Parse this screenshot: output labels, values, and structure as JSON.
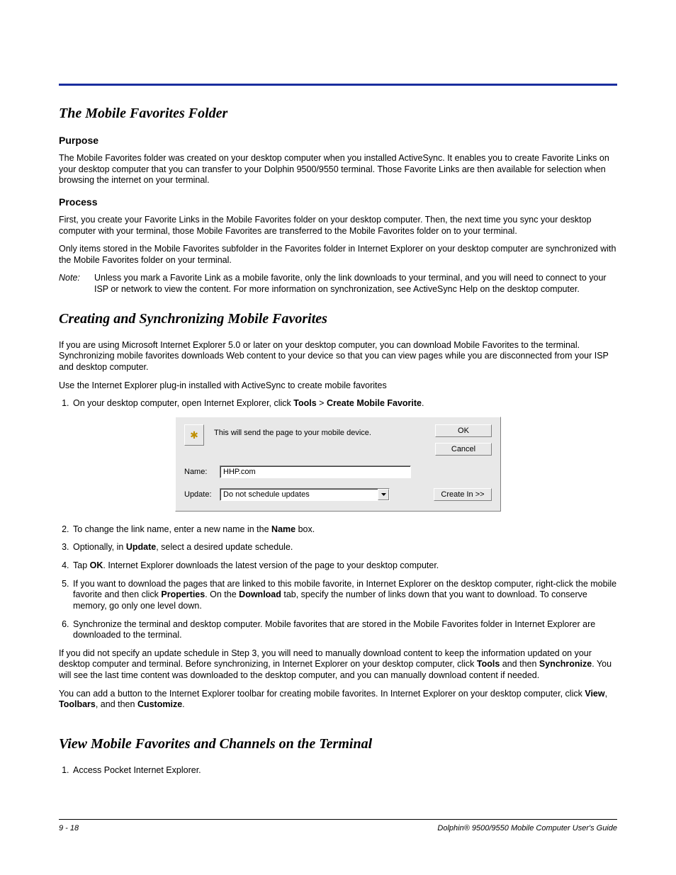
{
  "sections": {
    "s1": {
      "title": "The Mobile Favorites Folder",
      "purpose_h": "Purpose",
      "purpose_p": "The Mobile Favorites folder was created on your desktop computer when you installed ActiveSync. It enables you to create Favorite Links on your desktop computer that you can transfer to your Dolphin 9500/9550 terminal. Those Favorite Links are then available for selection when browsing the internet on your terminal.",
      "process_h": "Process",
      "process_p1": "First, you create your Favorite Links in the Mobile Favorites folder on your desktop computer. Then, the next time you sync your desktop computer with your terminal, those Mobile Favorites are transferred to the Mobile Favorites folder on to your terminal.",
      "process_p2": "Only items stored in the Mobile Favorites subfolder in the Favorites folder in Internet Explorer on your desktop computer are synchronized with the Mobile Favorites folder on your terminal.",
      "note_label": "Note:",
      "note_body": "Unless you mark a Favorite Link as a mobile favorite, only the link downloads to your terminal, and you will need to connect to your ISP or network to view the content. For more information on synchronization, see ActiveSync Help on the desktop computer."
    },
    "s2": {
      "title": "Creating and Synchronizing Mobile Favorites",
      "p1": "If you are using Microsoft Internet Explorer 5.0 or later on your desktop computer, you can download Mobile Favorites to the terminal. Synchronizing mobile favorites downloads Web content to your device so that you can view pages while you are disconnected from your ISP and desktop computer.",
      "p2": "Use the Internet Explorer plug-in installed with ActiveSync to create mobile favorites",
      "step1_pre": "On your desktop computer, open Internet Explorer, click ",
      "step1_b1": "Tools",
      "step1_gt": " > ",
      "step1_b2": "Create Mobile Favorite",
      "step1_post": ".",
      "step2_pre": "To change the link name, enter a new name in the ",
      "step2_b": "Name",
      "step2_post": " box.",
      "step3_pre": "Optionally, in ",
      "step3_b": "Update",
      "step3_post": ", select a desired update schedule.",
      "step4_pre": "Tap ",
      "step4_b": "OK",
      "step4_post": ". Internet Explorer downloads the latest version of the page to your desktop computer.",
      "step5_pre": "If you want to download the pages that are linked to this mobile favorite, in Internet Explorer on the desktop computer, right-click the mobile favorite and then click ",
      "step5_b1": "Properties",
      "step5_mid": ". On the ",
      "step5_b2": "Download",
      "step5_post": " tab, specify the number of links down that you want to download. To conserve memory, go only one level down.",
      "step6": "Synchronize the terminal and desktop computer. Mobile favorites that are stored in the Mobile Favorites folder in Internet Explorer are downloaded to the terminal.",
      "after1_pre": "If you did not specify an update schedule in Step 3, you will need to manually download content to keep the information updated on your desktop computer and terminal. Before synchronizing, in Internet Explorer on your desktop computer, click ",
      "after1_b1": "Tools",
      "after1_mid": " and then ",
      "after1_b2": "Synchronize",
      "after1_post": ". You will see the last time content was downloaded to the desktop computer, and you can manually download content if needed.",
      "after2_pre": "You can add a button to the Internet Explorer toolbar for creating mobile favorites. In Internet Explorer on your desktop computer, click ",
      "after2_b1": "View",
      "after2_c1": ", ",
      "after2_b2": "Toolbars",
      "after2_c2": ", and then ",
      "after2_b3": "Customize",
      "after2_post": "."
    },
    "s3": {
      "title": "View Mobile Favorites and Channels on the Terminal",
      "step1": "Access Pocket Internet Explorer."
    }
  },
  "dialog": {
    "msg": "This will send the page to your mobile device.",
    "ok": "OK",
    "cancel": "Cancel",
    "name_label": "Name:",
    "name_value": "HHP.com",
    "update_label": "Update:",
    "update_value": "Do not schedule updates",
    "createin": "Create In >>"
  },
  "footer": {
    "left": "9 - 18",
    "right": "Dolphin® 9500/9550 Mobile Computer User's Guide"
  }
}
